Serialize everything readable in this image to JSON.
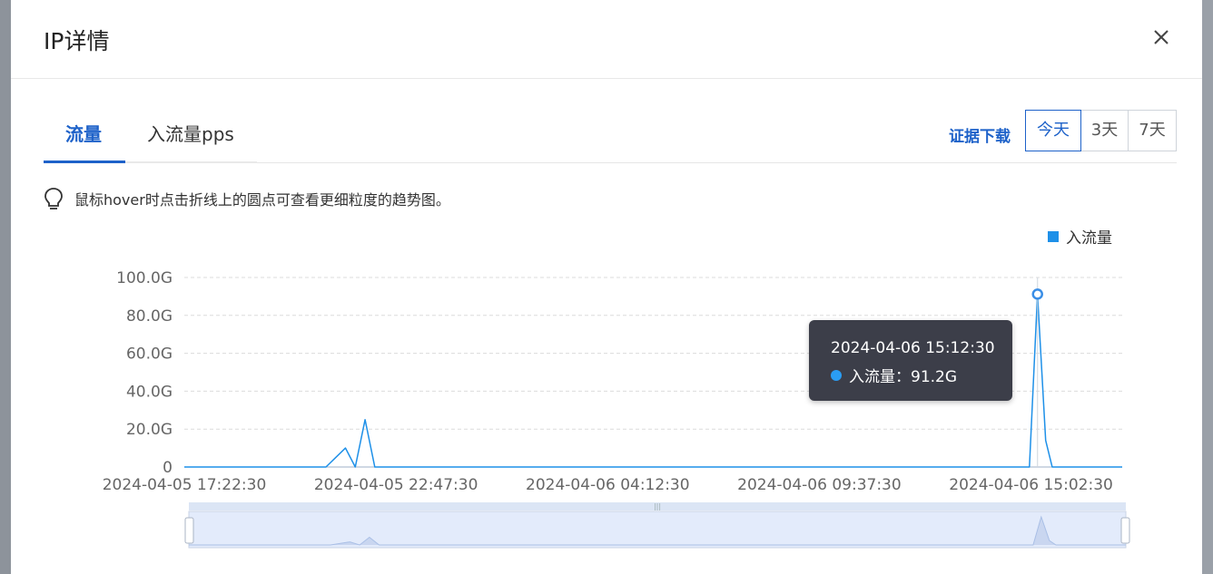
{
  "dialog": {
    "title": "IP详情"
  },
  "tabs": [
    {
      "label": "流量",
      "active": true
    },
    {
      "label": "入流量pps",
      "active": false
    }
  ],
  "toolbar": {
    "download_label": "证据下载",
    "ranges": [
      {
        "label": "今天",
        "active": true
      },
      {
        "label": "3天",
        "active": false
      },
      {
        "label": "7天",
        "active": false
      }
    ]
  },
  "hint": {
    "icon": "lightbulb-icon",
    "text": "鼠标hover时点击折线上的圆点可查看更细粒度的趋势图。"
  },
  "tooltip": {
    "time": "2024-04-06 15:12:30",
    "label": "入流量：91.2G"
  },
  "colors": {
    "accent": "#1e62c9",
    "series": "#1e90e8",
    "tooltip_bg": "#3c3e49"
  },
  "chart_data": {
    "type": "line",
    "title": "",
    "xlabel": "",
    "ylabel": "",
    "legend": {
      "entries": [
        "入流量"
      ],
      "position": "top-right"
    },
    "y_ticks": [
      "0",
      "20.0G",
      "40.0G",
      "60.0G",
      "80.0G",
      "100.0G"
    ],
    "ylim": [
      0,
      100
    ],
    "x_tick_labels": [
      "2024-04-05 17:22:30",
      "2024-04-05 22:47:30",
      "2024-04-06 04:12:30",
      "2024-04-06 09:37:30",
      "2024-04-06 15:02:30"
    ],
    "xlim": [
      "2024-04-05 17:22:30",
      "2024-04-06 17:22:30"
    ],
    "grid": true,
    "series": [
      {
        "name": "入流量",
        "unit": "G",
        "points": [
          [
            "2024-04-05 17:22:30",
            0
          ],
          [
            "2024-04-05 21:00:00",
            0
          ],
          [
            "2024-04-05 21:30:00",
            10
          ],
          [
            "2024-04-05 21:45:00",
            0
          ],
          [
            "2024-04-05 22:00:00",
            25
          ],
          [
            "2024-04-05 22:15:00",
            0
          ],
          [
            "2024-04-06 15:00:00",
            0
          ],
          [
            "2024-04-06 15:12:30",
            91.2
          ],
          [
            "2024-04-06 15:25:00",
            14
          ],
          [
            "2024-04-06 15:35:00",
            0
          ],
          [
            "2024-04-06 17:22:30",
            0
          ]
        ],
        "highlight": [
          "2024-04-06 15:12:30",
          91.2
        ]
      }
    ]
  }
}
